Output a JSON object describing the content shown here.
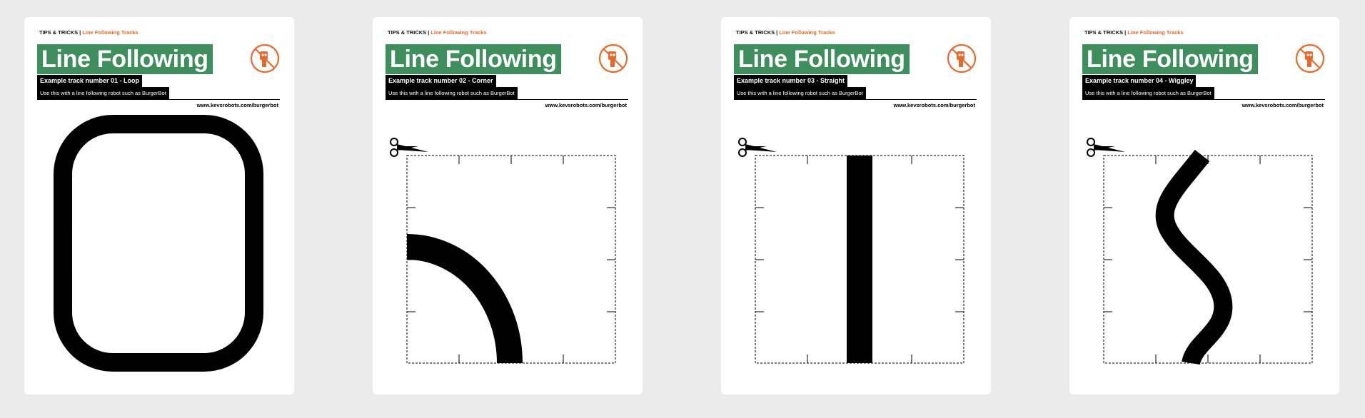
{
  "brand": {
    "accent": "#e66a2c",
    "title_bg": "#3f8e5d"
  },
  "cards": [
    {
      "kicker": "TIPS & TRICKS",
      "kicker_sep": "|",
      "series": "Line Following Tracks",
      "title": "Line Following",
      "subtitle": "Example track number 01 - Loop",
      "description": "Use this with a line following robot such as BurgerBot",
      "url": "www.kevsrobots.com/burgerbot",
      "track": "loop"
    },
    {
      "kicker": "TIPS & TRICKS",
      "kicker_sep": "|",
      "series": "Line Following Tracks",
      "title": "Line Following",
      "subtitle": "Example track number 02 - Corner",
      "description": "Use this with a line following robot such as BurgerBot",
      "url": "www.kevsrobots.com/burgerbot",
      "track": "corner"
    },
    {
      "kicker": "TIPS & TRICKS",
      "kicker_sep": "|",
      "series": "Line Following Tracks",
      "title": "Line Following",
      "subtitle": "Example track number 03 - Straight",
      "description": "Use this with a line following robot such as BurgerBot",
      "url": "www.kevsrobots.com/burgerbot",
      "track": "straight"
    },
    {
      "kicker": "TIPS & TRICKS",
      "kicker_sep": "|",
      "series": "Line Following Tracks",
      "title": "Line Following",
      "subtitle": "Example track number 04 - Wiggley",
      "description": "Use this with a line following robot such as BurgerBot",
      "url": "www.kevsrobots.com/burgerbot",
      "track": "wiggley"
    }
  ]
}
